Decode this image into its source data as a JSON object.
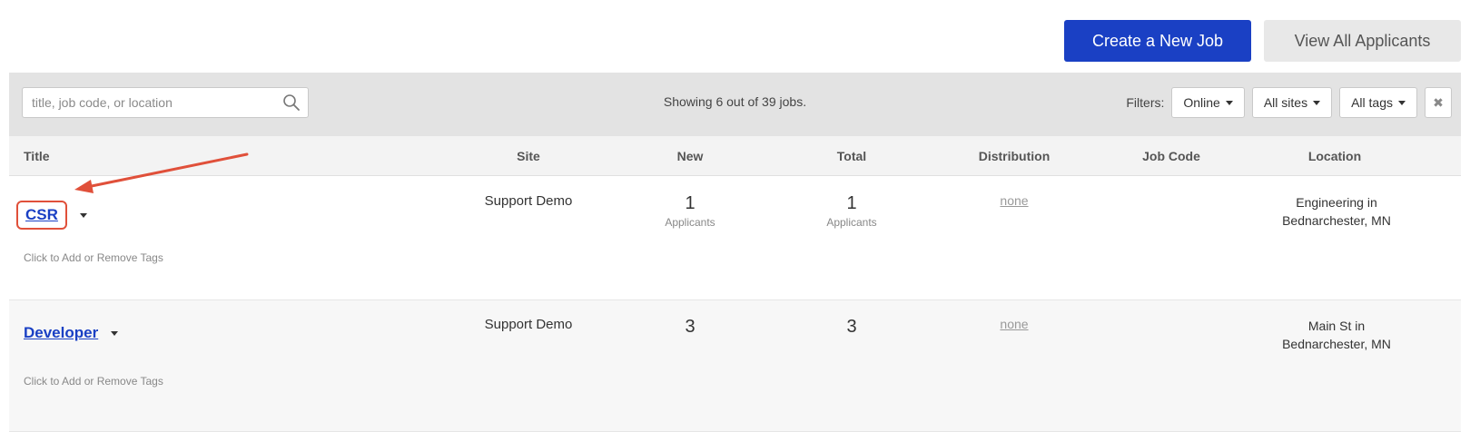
{
  "actions": {
    "create_label": "Create a New Job",
    "view_label": "View All Applicants"
  },
  "toolbar": {
    "search_placeholder": "title, job code, or location",
    "showing": "Showing 6 out of 39 jobs.",
    "filters_label": "Filters:",
    "filter_online": "Online",
    "filter_sites": "All sites",
    "filter_tags": "All tags",
    "clear_glyph": "✖"
  },
  "columns": {
    "title": "Title",
    "site": "Site",
    "new": "New",
    "total": "Total",
    "distribution": "Distribution",
    "job_code": "Job Code",
    "location": "Location"
  },
  "jobs": [
    {
      "title": "CSR",
      "site": "Support Demo",
      "new": "1",
      "new_sub": "Applicants",
      "total": "1",
      "total_sub": "Applicants",
      "distribution": "none",
      "job_code": "",
      "location_line1": "Engineering in",
      "location_line2": "Bednarchester, MN",
      "tags": "Click to Add or Remove Tags"
    },
    {
      "title": "Developer",
      "site": "Support Demo",
      "new": "3",
      "total": "3",
      "distribution": "none",
      "job_code": "",
      "location_line1": "Main St in",
      "location_line2": "Bednarchester, MN",
      "tags": "Click to Add or Remove Tags"
    }
  ],
  "colors": {
    "primary": "#1a40c4",
    "highlight": "#e0503a"
  }
}
